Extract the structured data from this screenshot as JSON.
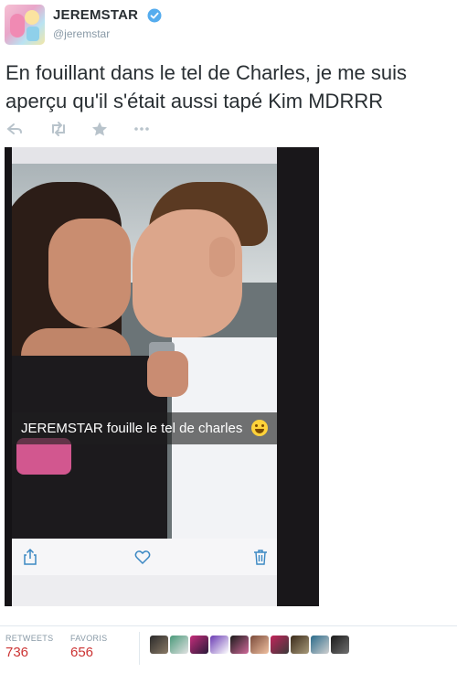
{
  "tweet": {
    "display_name": "JEREMSTAR",
    "handle": "@jeremstar",
    "text": "En fouillant dans le tel de Charles, je me suis aperçu qu'il s'était aussi tapé Kim MDRRR",
    "actions": [
      "reply-icon",
      "retweet-icon",
      "favorite-icon",
      "more-icon"
    ]
  },
  "media": {
    "caption": "JEREMSTAR fouille le tel de charles",
    "caption_emoji": "tears-of-joy-emoji",
    "toolbar_icons": [
      "share-icon",
      "heart-icon",
      "trash-icon"
    ]
  },
  "stats": {
    "retweets_label": "RETWEETS",
    "retweets_value": "736",
    "favorites_label": "FAVORIS",
    "favorites_value": "656"
  },
  "colors": {
    "text": "#292f33",
    "muted": "#8899a6",
    "accent_blue": "#55acee",
    "stat_red": "#cc3333"
  }
}
